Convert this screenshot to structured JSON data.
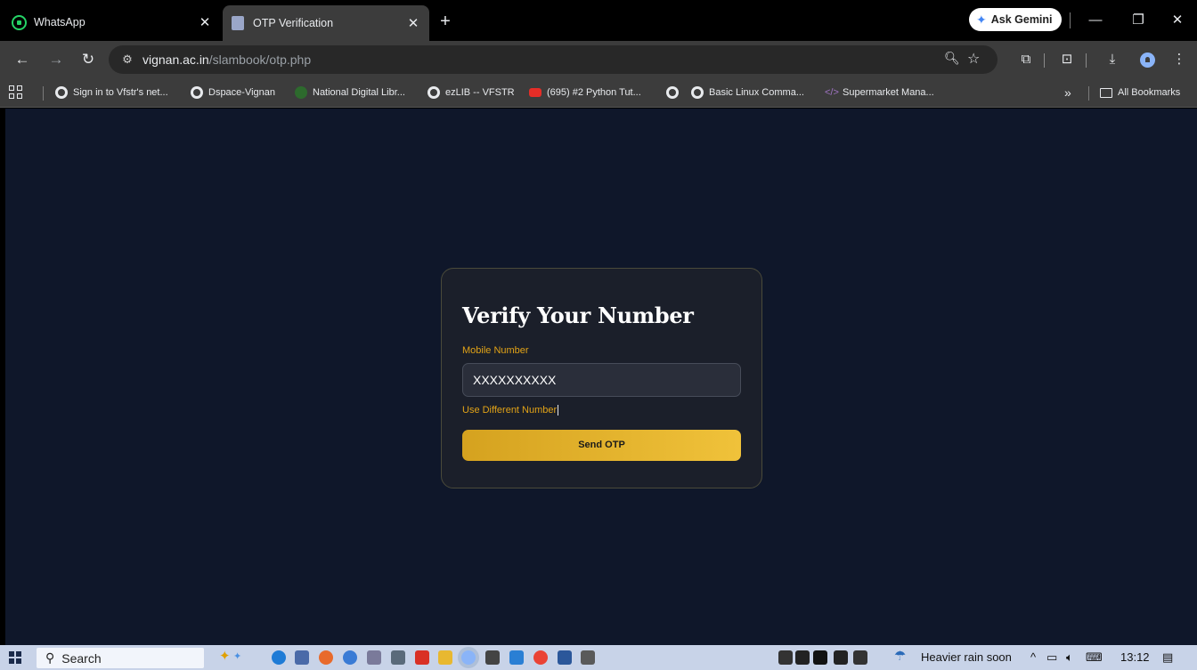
{
  "tabs": [
    {
      "title": "WhatsApp",
      "icon": "whatsapp-icon",
      "active": false
    },
    {
      "title": "OTP Verification",
      "icon": "page-icon",
      "active": true
    }
  ],
  "toolbar": {
    "gemini_label": "Ask Gemini",
    "url_host": "vignan.ac.in",
    "url_path": "/slambook/otp.php"
  },
  "bookmarks": [
    {
      "label": "Sign in to Vfstr's net...",
      "icon": "globe-icon"
    },
    {
      "label": "Dspace-Vignan",
      "icon": "globe-icon"
    },
    {
      "label": "National Digital Libr...",
      "icon": "ndl-icon"
    },
    {
      "label": "ezLIB -- VFSTR",
      "icon": "globe-icon"
    },
    {
      "label": "(695) #2 Python Tut...",
      "icon": "youtube-icon"
    },
    {
      "label": "",
      "icon": "globe-icon"
    },
    {
      "label": "Basic Linux Comma...",
      "icon": "globe-icon"
    },
    {
      "label": "Supermarket Mana...",
      "icon": "code-icon"
    }
  ],
  "bookmarks_more": "»",
  "all_bookmarks": "All Bookmarks",
  "card": {
    "title": "Verify Your Number",
    "mobile_label": "Mobile Number",
    "mobile_value": "XXXXXXXXXX",
    "different_link": "Use Different Number",
    "send_button": "Send OTP"
  },
  "taskbar": {
    "search_label": "Search",
    "weather": "Heavier rain soon",
    "time": "13:12"
  },
  "colors": {
    "page_bg": "#0f172a",
    "card_bg": "#1b1f2a",
    "accent": "#e2a317",
    "button_gradient_start": "#d5a21f",
    "button_gradient_end": "#f0c23a"
  }
}
